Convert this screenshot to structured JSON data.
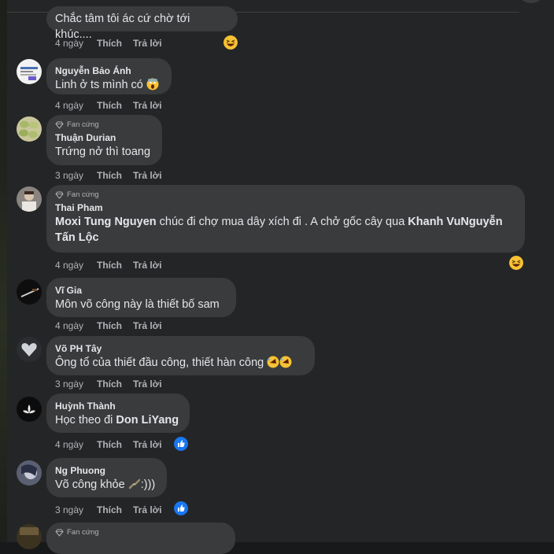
{
  "labels": {
    "like": "Thích",
    "reply": "Trả lời"
  },
  "comments": [
    {
      "author": "",
      "text": "Chắc tâm tôi ác cứ chờ tới khúc....",
      "age": "4 ngày"
    },
    {
      "author": "Nguyễn Bảo Ánh",
      "text": "Linh ở ts mình có",
      "age": "4 ngày"
    },
    {
      "badge": "Fan cứng",
      "author": "Thuận Durian",
      "text": "Trứng nở thì toang",
      "age": "3 ngày"
    },
    {
      "badge": "Fan cứng",
      "author": "Thai Pham",
      "mention1": "Moxi Tung Nguyen",
      "text_mid": " chúc đi chợ mua dây xích đi . A chở gốc cây qua ",
      "mention2": "Khanh VuNguyễn Tấn Lộc",
      "age": "4 ngày"
    },
    {
      "author": "Vĩ Gia",
      "text": "Môn võ công này là thiết bố sam",
      "age": "4 ngày"
    },
    {
      "author": "Võ PH Tây",
      "text": "Ông tổ của thiết đầu công, thiết hàn công",
      "age": "3 ngày"
    },
    {
      "author": "Huỳnh Thành",
      "text": "Học theo đi ",
      "mention": "Don LiYang",
      "age": "4 ngày"
    },
    {
      "author": "Ng Phuong",
      "text_a": "Võ công khỏe",
      "text_b": ":)))",
      "age": "3 ngày"
    },
    {
      "badge": "Fan cứng"
    }
  ],
  "icons": {
    "grin": "grinning-squint-emoji-icon",
    "scream": "scream-emoji-icon",
    "rofl": "rolling-laughing-emoji-icon",
    "like": "like-reaction-icon",
    "diamond": "diamond-icon",
    "nunchaku": "nunchaku-emoji-icon"
  },
  "colors": {
    "background": "#242526",
    "bubble": "#3a3b3c",
    "text": "#e4e6eb",
    "meta": "#b0b3b8",
    "like_blue": "#1877f2"
  }
}
